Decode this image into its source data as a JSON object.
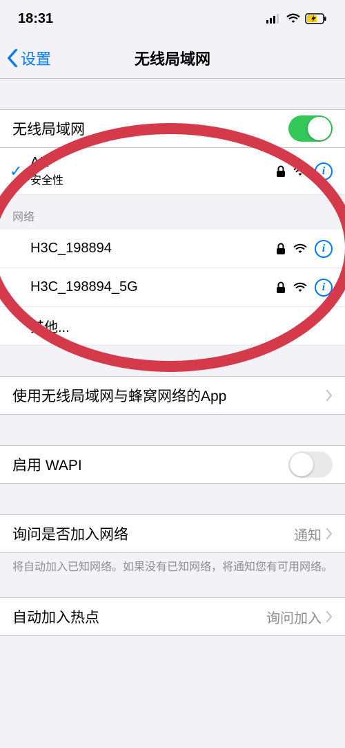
{
  "status": {
    "time": "18:31"
  },
  "nav": {
    "back": "设置",
    "title": "无线局域网"
  },
  "wlan": {
    "toggle_label": "无线局域网",
    "toggle_on": true,
    "connected": {
      "name": "AK",
      "sub": "安全性"
    }
  },
  "networks": {
    "header": "网络",
    "items": [
      {
        "name": "H3C_198894"
      },
      {
        "name": "H3C_198894_5G"
      }
    ],
    "other": "其他..."
  },
  "apps": {
    "label": "使用无线局域网与蜂窝网络的App"
  },
  "wapi": {
    "label": "启用 WAPI",
    "on": false
  },
  "ask": {
    "label": "询问是否加入网络",
    "value": "通知",
    "note": "将自动加入已知网络。如果没有已知网络，将通知您有可用网络。"
  },
  "hotspot": {
    "label": "自动加入热点",
    "value": "询问加入"
  }
}
